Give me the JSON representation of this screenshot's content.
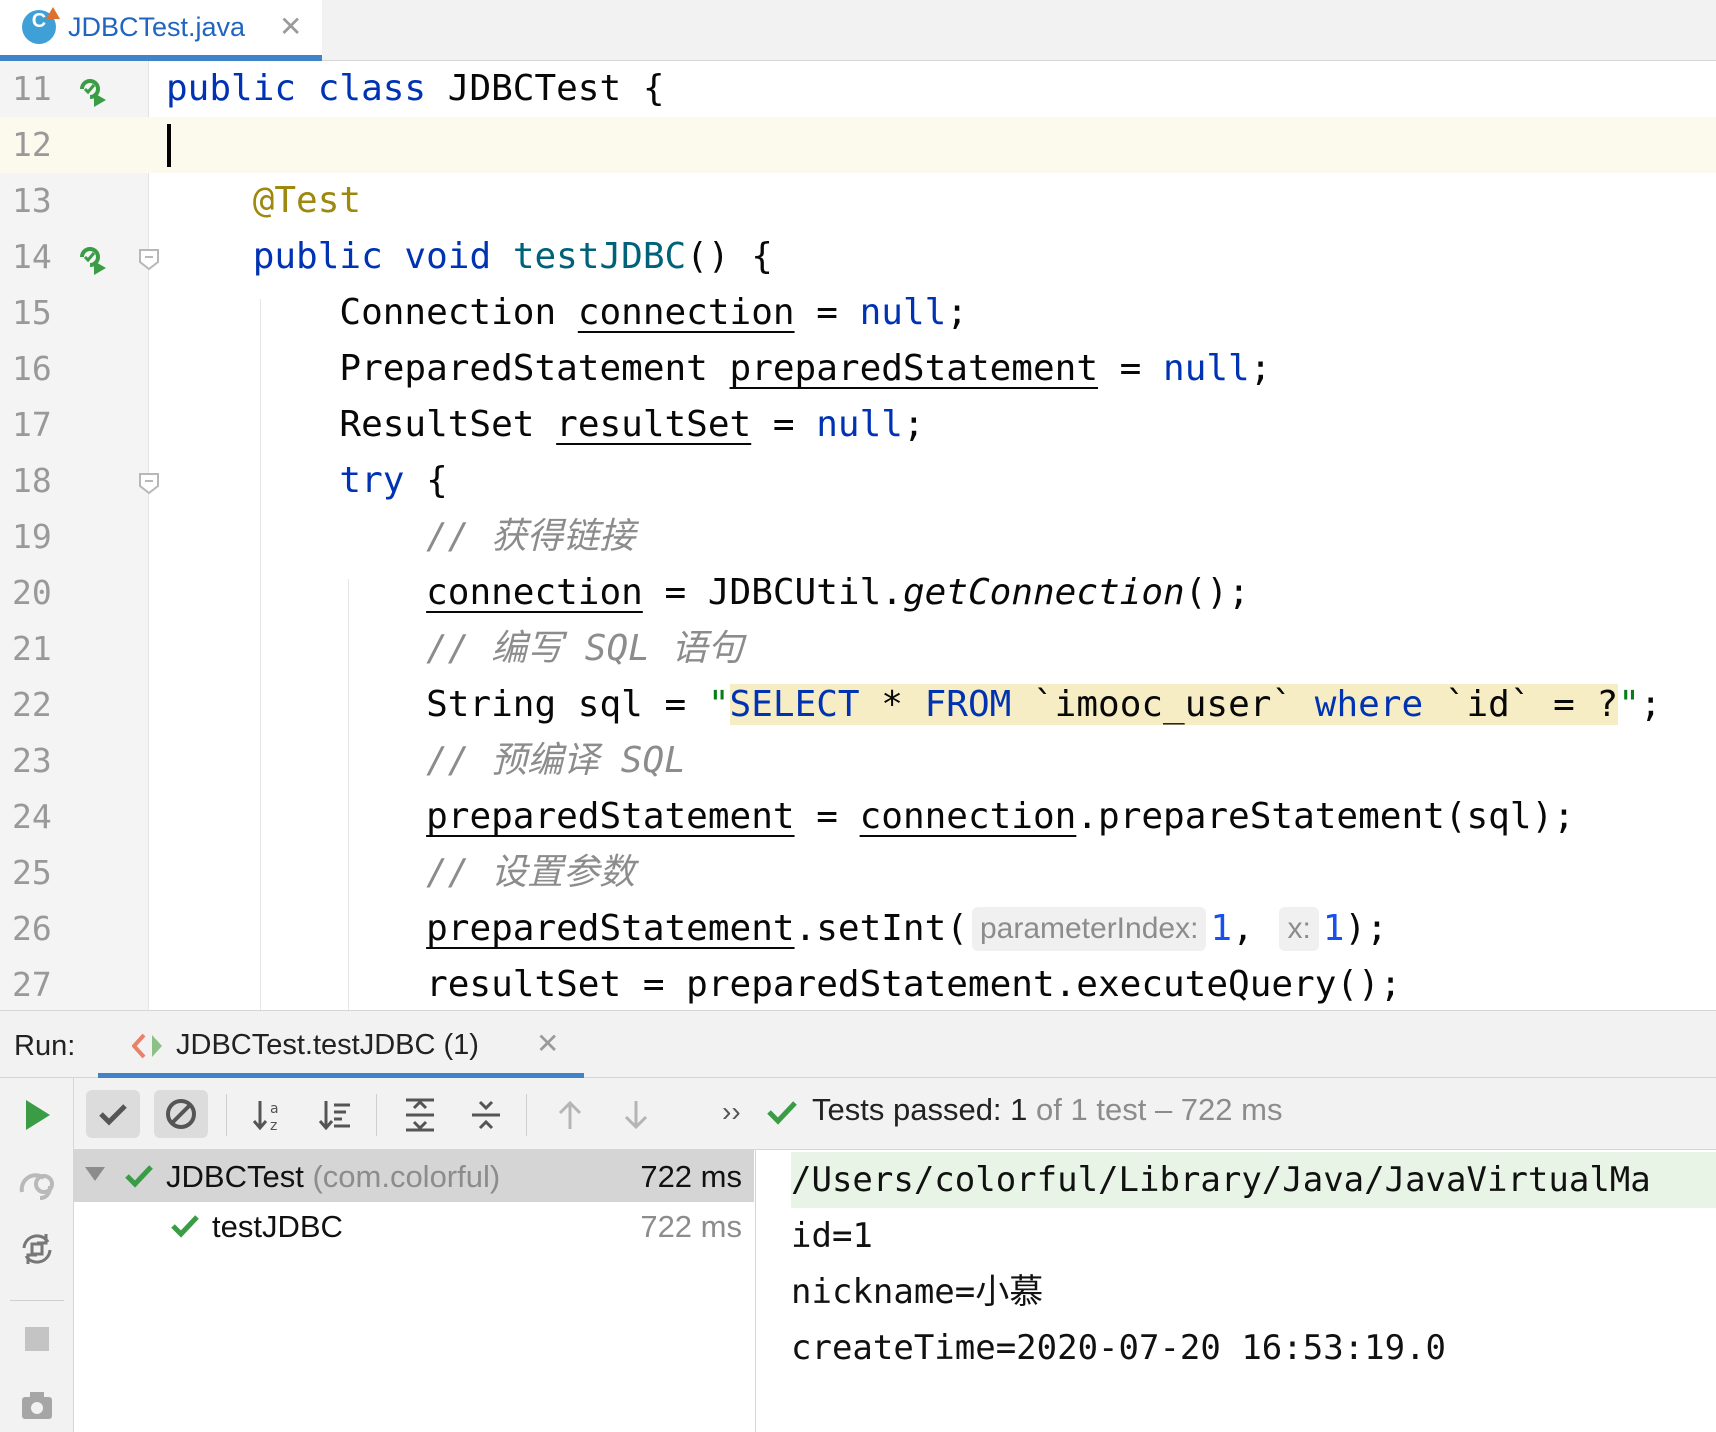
{
  "tab": {
    "filename": "JDBCTest.java",
    "icon_letter": "C",
    "close": "✕"
  },
  "editor": {
    "lines": [
      {
        "n": "11",
        "html": "<span class='kw'>public class</span> JDBCTest {"
      },
      {
        "n": "12",
        "html": ""
      },
      {
        "n": "13",
        "html": "    <span class='ann'>@Test</span>"
      },
      {
        "n": "14",
        "html": "    <span class='kw'>public void</span> <span class='fn'>testJDBC</span>() {"
      },
      {
        "n": "15",
        "html": "        Connection <span class='u'>connection</span> = <span class='kw'>null</span>;"
      },
      {
        "n": "16",
        "html": "        PreparedStatement <span class='u'>preparedStatement</span> = <span class='kw'>null</span>;"
      },
      {
        "n": "17",
        "html": "        ResultSet <span class='u'>resultSet</span> = <span class='kw'>null</span>;"
      },
      {
        "n": "18",
        "html": "        <span class='kw'>try</span> {"
      },
      {
        "n": "19",
        "html": "            <span class='cm'>// 获得链接</span>"
      },
      {
        "n": "20",
        "html": "            <span class='u'>connection</span> = JDBCUtil.<span class='it'>getConnection</span>();"
      },
      {
        "n": "21",
        "html": "            <span class='cm'>// 编写 SQL 语句</span>"
      },
      {
        "n": "22",
        "html": "            String sql = <span class='str'>\"</span><span class='sqlbg'><span class='sqlkw'>SELECT</span> * <span class='sqlkw'>FROM</span> `imooc_user` <span class='sqlkw'>where</span> `id` = ?</span><span class='str'>\"</span>;"
      },
      {
        "n": "23",
        "html": "            <span class='cm'>// 预编译 SQL</span>"
      },
      {
        "n": "24",
        "html": "            <span class='u'>preparedStatement</span> = <span class='u'>connection</span>.prepareStatement(sql);"
      },
      {
        "n": "25",
        "html": "            <span class='cm'>// 设置参数</span>"
      },
      {
        "n": "26",
        "html": "            <span class='u'>preparedStatement</span>.setInt(<span class='hint'>parameterIndex:</span><span class='num'>1</span>, <span class='hint'>x:</span><span class='num'>1</span>);"
      },
      {
        "n": "27",
        "html": "            resultSet = preparedStatement.executeQuery();"
      }
    ]
  },
  "run": {
    "label": "Run:",
    "tab_title": "JDBCTest.testJDBC (1)",
    "tab_close": "✕",
    "more": "››",
    "status": {
      "prefix": "Tests passed:",
      "count": "1",
      "suffix": "of 1 test – 722 ms"
    },
    "tree": [
      {
        "name": "JDBCTest",
        "pkg": "(com.colorful)",
        "duration": "722 ms"
      },
      {
        "name": "testJDBC",
        "duration": "722 ms"
      }
    ],
    "console": [
      "/Users/colorful/Library/Java/JavaVirtualMa",
      "id=1",
      "nickname=小慕",
      "createTime=2020-07-20 16:53:19.0"
    ]
  },
  "colors": {
    "accent": "#4083c9",
    "keyword": "#0033b3",
    "success": "#3a9c45"
  }
}
